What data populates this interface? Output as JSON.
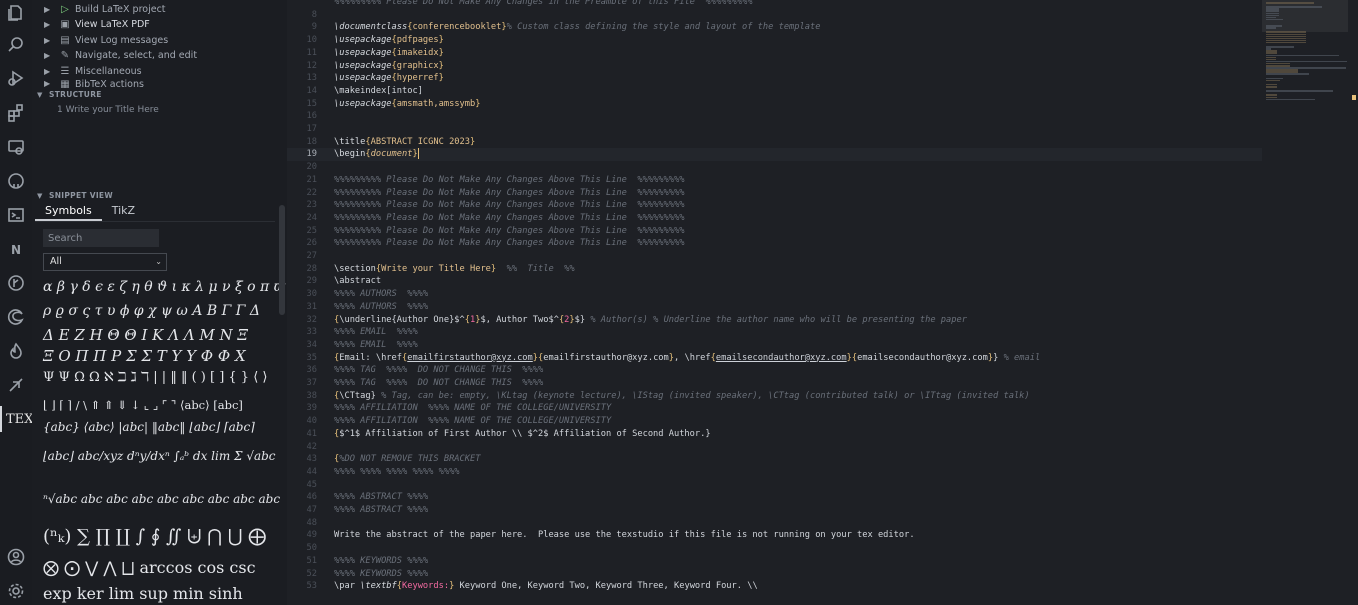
{
  "sidebar": {
    "commands": [
      {
        "label": "Build LaTeX project",
        "icon": "play-icon",
        "highlighted": false
      },
      {
        "label": "View LaTeX PDF",
        "icon": "preview-icon",
        "highlighted": true
      },
      {
        "label": "View Log messages",
        "icon": "log-icon",
        "highlighted": false
      },
      {
        "label": "Navigate, select, and edit",
        "icon": "pencil-icon",
        "highlighted": false
      },
      {
        "label": "Miscellaneous",
        "icon": "menu-icon",
        "highlighted": false
      },
      {
        "label": "BibTeX actions",
        "icon": "bib-icon",
        "highlighted": false
      }
    ],
    "structure_title": "STRUCTURE",
    "structure_items": [
      "1 Write your Title Here"
    ],
    "snippet_title": "SNIPPET VIEW",
    "tabs": [
      {
        "label": "Symbols",
        "selected": true
      },
      {
        "label": "TikZ",
        "selected": false
      }
    ],
    "search_placeholder": "Search",
    "filter_value": "All",
    "symbol_rows": [
      "α β γ δ ϵ ε ζ η θ ϑ ι κ λ μ ν ξ ο π ϖ",
      "ρ ϱ σ ς τ υ ϕ φ χ ψ ω A B Γ Γ Δ",
      "Δ E Z H Θ Θ I K Λ Λ M N Ξ",
      "Ξ O Π Π P Σ Σ T Υ Υ Φ Φ X",
      "Ψ Ψ Ω Ω ℵ ℶ ℷ ℸ | | ‖ ‖ ( ) [ ] { } ⟨ ⟩",
      "⌊ ⌋ ⌈ ⌉ / \\ ⇑ ⇑ ⇓ ↓ ⌞ ⌟ ⌜ ⌝ ⟨abc⟩ [abc]",
      "{abc} ⟨abc⟩ |abc| ‖abc‖ ⌊abc⌋ ⌈abc⌉",
      "⌊abc⌋ abc/xyz dⁿy/dxⁿ ∫ₐᵇ dx lim Σ √abc",
      "ⁿ√abc abc abc abc abc abc abc abc abc",
      "(ⁿₖ) ∑ ∏ ∐ ∫ ∮ ∬ ⨄ ⋂ ⋃ ⨁",
      "⨂ ⨀ ⋁ ⋀ ⨆ arccos cos csc",
      "exp ker lim sup min sinh"
    ]
  },
  "activity_icons": [
    "explorer-icon",
    "search-icon",
    "run-debug-icon",
    "extensions-icon",
    "remote-icon",
    "github-icon",
    "terminal-icon",
    "n-icon",
    "git-icon",
    "edge-icon",
    "flame-icon",
    "lightning-icon",
    "tex-icon",
    "account-icon",
    "settings-icon"
  ],
  "tex_label": "TEX",
  "editor": {
    "current_line": "19",
    "lines": [
      {
        "n": "",
        "t": "%%%%%%%%% Please Do Not Make Any Changes in the Preamble of this File  %%%%%%%%%"
      },
      {
        "n": "8",
        "t": ""
      },
      {
        "n": "9",
        "t": "\\documentclass{conferencebooklet}% Custom class defining the style and layout of the template"
      },
      {
        "n": "10",
        "t": "\\usepackage{pdfpages}"
      },
      {
        "n": "11",
        "t": "\\usepackage{imakeidx}"
      },
      {
        "n": "12",
        "t": "\\usepackage{graphicx}"
      },
      {
        "n": "13",
        "t": "\\usepackage{hyperref}"
      },
      {
        "n": "14",
        "t": "\\makeindex[intoc]"
      },
      {
        "n": "15",
        "t": "\\usepackage{amsmath,amssymb}"
      },
      {
        "n": "16",
        "t": ""
      },
      {
        "n": "17",
        "t": ""
      },
      {
        "n": "18",
        "t": "\\title{ABSTRACT ICGNC 2023}"
      },
      {
        "n": "19",
        "t": "\\begin{document}"
      },
      {
        "n": "20",
        "t": ""
      },
      {
        "n": "21",
        "t": "%%%%%%%%% Please Do Not Make Any Changes Above This Line  %%%%%%%%%"
      },
      {
        "n": "22",
        "t": "%%%%%%%%% Please Do Not Make Any Changes Above This Line  %%%%%%%%%"
      },
      {
        "n": "23",
        "t": "%%%%%%%%% Please Do Not Make Any Changes Above This Line  %%%%%%%%%"
      },
      {
        "n": "24",
        "t": "%%%%%%%%% Please Do Not Make Any Changes Above This Line  %%%%%%%%%"
      },
      {
        "n": "25",
        "t": "%%%%%%%%% Please Do Not Make Any Changes Above This Line  %%%%%%%%%"
      },
      {
        "n": "26",
        "t": "%%%%%%%%% Please Do Not Make Any Changes Above This Line  %%%%%%%%%"
      },
      {
        "n": "27",
        "t": ""
      },
      {
        "n": "28",
        "t": "\\section{Write your Title Here}  %%  Title  %%"
      },
      {
        "n": "29",
        "t": "\\abstract"
      },
      {
        "n": "30",
        "t": "%%%% AUTHORS  %%%%"
      },
      {
        "n": "31",
        "t": "%%%% AUTHORS  %%%%"
      },
      {
        "n": "32",
        "t": "{\\underline{Author One}$^{1}$, Author Two$^{2}$} % Author(s) % Underline the author name who will be presenting the paper"
      },
      {
        "n": "33",
        "t": "%%%% EMAIL  %%%%"
      },
      {
        "n": "34",
        "t": "%%%% EMAIL  %%%%"
      },
      {
        "n": "35",
        "t": "{Email: \\href{emailfirstauthor@xyz.com}{emailfirstauthor@xyz.com}, \\href{emailsecondauthor@xyz.com}{emailsecondauthor@xyz.com}} % email"
      },
      {
        "n": "36",
        "t": "%%%% TAG  %%%%  DO NOT CHANGE THIS  %%%%"
      },
      {
        "n": "37",
        "t": "%%%% TAG  %%%%  DO NOT CHANGE THIS  %%%%"
      },
      {
        "n": "38",
        "t": "{\\CTtag} % Tag, can be: empty, \\KLtag (keynote lecture), \\IStag (invited speaker), \\CTtag (contributed talk) or \\ITtag (invited talk)"
      },
      {
        "n": "39",
        "t": "%%%% AFFILIATION  %%%% NAME OF THE COLLEGE/UNIVERSITY"
      },
      {
        "n": "40",
        "t": "%%%% AFFILIATION  %%%% NAME OF THE COLLEGE/UNIVERSITY"
      },
      {
        "n": "41",
        "t": "{$^1$ Affiliation of First Author \\\\ $^2$ Affiliation of Second Author.}"
      },
      {
        "n": "42",
        "t": ""
      },
      {
        "n": "43",
        "t": "{%DO NOT REMOVE THIS BRACKET"
      },
      {
        "n": "44",
        "t": "%%%% %%%% %%%% %%%% %%%%"
      },
      {
        "n": "45",
        "t": ""
      },
      {
        "n": "46",
        "t": "%%%% ABSTRACT %%%%"
      },
      {
        "n": "47",
        "t": "%%%% ABSTRACT %%%%"
      },
      {
        "n": "48",
        "t": ""
      },
      {
        "n": "49",
        "t": "Write the abstract of the paper here.  Please use the texstudio if this file is not running on your tex editor."
      },
      {
        "n": "50",
        "t": ""
      },
      {
        "n": "51",
        "t": "%%%% KEYWORDS %%%%"
      },
      {
        "n": "52",
        "t": "%%%% KEYWORDS %%%%"
      },
      {
        "n": "53",
        "t": "\\par \\textbf{Keywords:} Keyword One, Keyword Two, Keyword Three, Keyword Four. \\\\"
      }
    ]
  }
}
